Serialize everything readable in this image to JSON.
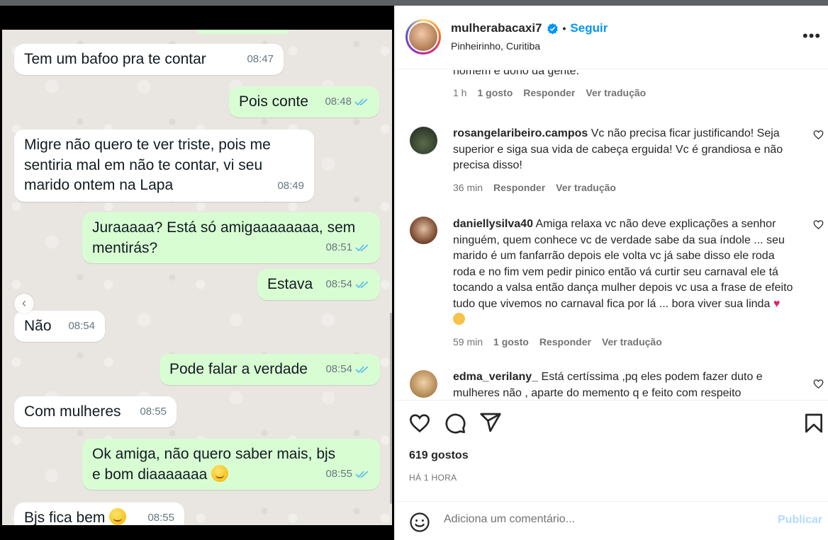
{
  "post": {
    "username": "mulherabacaxi7",
    "separator": "•",
    "follow_label": "Seguir",
    "location": "Pinheirinho, Curitiba",
    "more_icon": "more-options-icon",
    "likes": "619 gostos",
    "time_ago": "HÁ 1 HORA",
    "comment_placeholder": "Adiciona um comentário...",
    "publish_label": "Publicar",
    "accent_color": "#0095f6"
  },
  "chat": {
    "messages": [
      {
        "dir": "in",
        "text": "Tem um bafoo pra te contar",
        "time": "08:47"
      },
      {
        "dir": "out",
        "text": "Pois conte",
        "time": "08:48"
      },
      {
        "dir": "in",
        "text": "Migre não quero te ver triste, pois me sentiria mal em não te contar, vi seu marido ontem na Lapa",
        "time": "08:49"
      },
      {
        "dir": "out",
        "text": "Juraaaaa? Está só amigaaaaaaaa, sem mentirás?",
        "time": "08:51"
      },
      {
        "dir": "out",
        "text": "Estava",
        "time": "08:54"
      },
      {
        "dir": "in",
        "text": "Não",
        "time": "08:54"
      },
      {
        "dir": "out",
        "text": "Pode falar a verdade",
        "time": "08:54"
      },
      {
        "dir": "in",
        "text": "Com mulheres",
        "time": "08:55"
      },
      {
        "dir": "out",
        "text": "Ok amiga, não quero saber mais, bjs e bom diaaaaaaa",
        "time": "08:55"
      },
      {
        "dir": "in",
        "text": "Bjs fica bem",
        "time": "08:55"
      }
    ]
  },
  "comments": {
    "partial_top": {
      "text": "homem e dono da gente.",
      "time": "1 h",
      "likes": "1 gosto",
      "reply": "Responder",
      "translate": "Ver tradução"
    },
    "items": [
      {
        "user": "rosangelaribeiro.campos",
        "text": "Vc não precisa ficar justificando! Seja superior e siga sua vida de cabeça erguida! Vc é grandiosa e não precisa disso!",
        "time": "36 min",
        "likes": "",
        "reply": "Responder",
        "translate": "Ver tradução"
      },
      {
        "user": "daniellysilva40",
        "text": "Amiga relaxa vc não deve explicações a senhor ninguém, quem conhece vc de verdade sabe da sua índole ... seu marido é um fanfarrão depois ele volta vc já sabe disso ele roda roda e no fim vem pedir pinico então vá curtir seu carnaval ele tá tocando a valsa então dança mulher depois vc usa a frase de efeito tudo que vivemos no carnaval fica por lá ... bora viver sua linda",
        "time": "59 min",
        "likes": "1 gosto",
        "reply": "Responder",
        "translate": "Ver tradução"
      },
      {
        "user": "edma_verilany_",
        "text": "Está certíssima ,pq eles podem fazer duto e mulheres não , aparte do memento q e feito com respeito",
        "time": "",
        "likes": "",
        "reply": "",
        "translate": ""
      }
    ]
  }
}
